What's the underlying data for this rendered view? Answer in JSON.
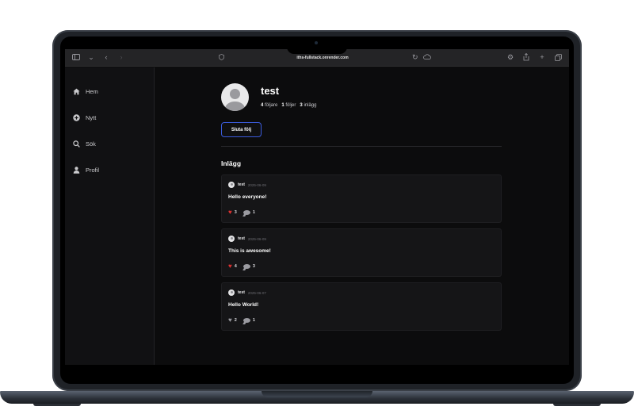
{
  "browser": {
    "url": "iths-fullstack.onrender.com",
    "left_icons": [
      "sidebar-toggle-icon",
      "chevron-down-icon",
      "back-icon",
      "forward-icon"
    ],
    "right_icons": [
      "settings-icon",
      "share-icon",
      "new-tab-icon",
      "tabs-overview-icon"
    ]
  },
  "sidebar": {
    "items": [
      {
        "label": "Hem",
        "icon": "home-icon"
      },
      {
        "label": "Nytt",
        "icon": "plus-circle-icon"
      },
      {
        "label": "Sök",
        "icon": "search-icon"
      },
      {
        "label": "Profil",
        "icon": "user-icon"
      }
    ]
  },
  "profile": {
    "username": "test",
    "followers_count": "4",
    "followers_label": "följare",
    "following_count": "1",
    "following_label": "följer",
    "posts_count": "3",
    "posts_label": "inlägg",
    "unfollow_label": "Sluta följ"
  },
  "posts_section": {
    "title": "Inlägg",
    "posts": [
      {
        "user": "test",
        "date": "2025-06-09",
        "text": "Hello everyone!",
        "likes": "3",
        "comments": "1",
        "liked": true
      },
      {
        "user": "test",
        "date": "2025-06-09",
        "text": "This is awesome!",
        "likes": "4",
        "comments": "3",
        "liked": true
      },
      {
        "user": "test",
        "date": "2025-06-07",
        "text": "Hello World!",
        "likes": "2",
        "comments": "1",
        "liked": false
      }
    ]
  },
  "colors": {
    "background": "#0c0c0d",
    "sidebar": "#111113",
    "card": "#151517",
    "accent_border": "#3b5bdb",
    "like_red": "#e03131"
  }
}
